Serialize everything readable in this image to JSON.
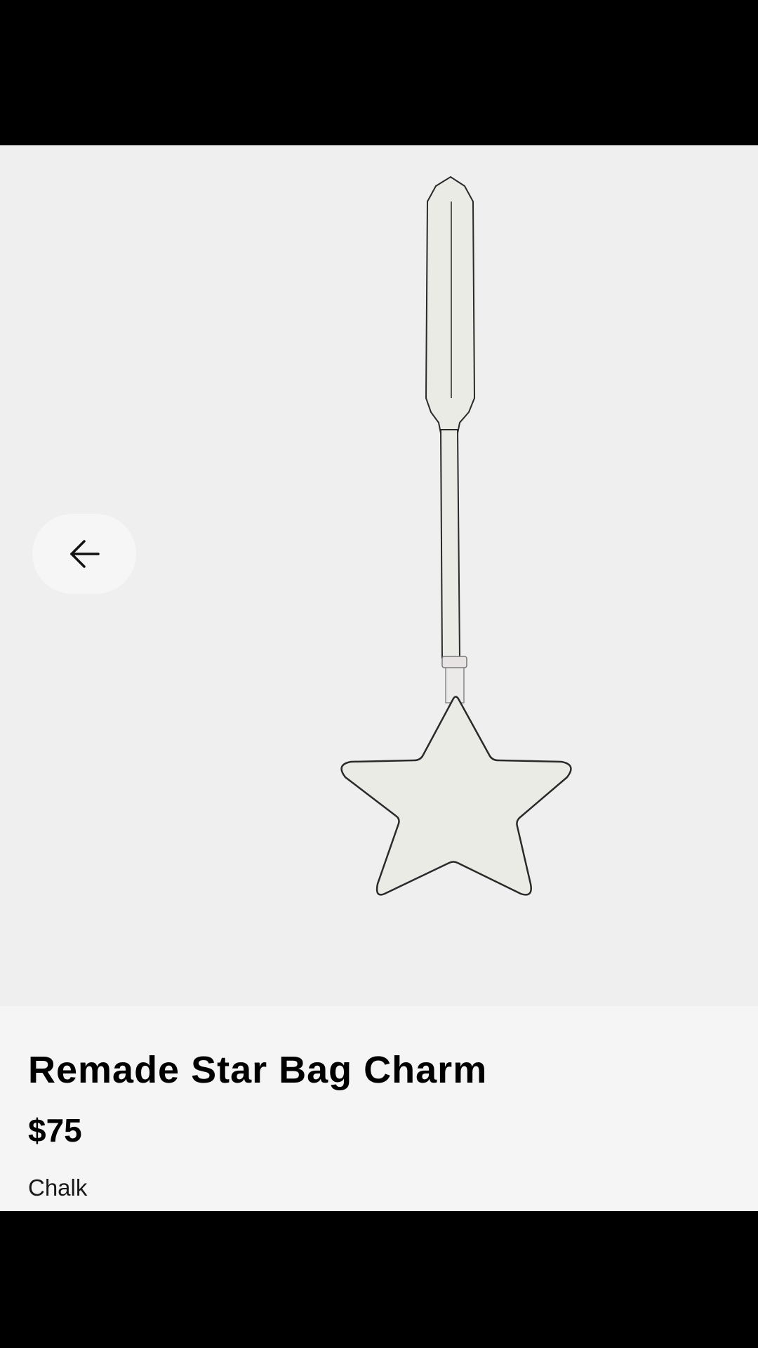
{
  "product": {
    "title": "Remade Star Bag Charm",
    "price": "$75",
    "color_name": "Chalk"
  },
  "image_area": {
    "background": "#efeff0",
    "subject": "star-bag-charm"
  },
  "back_button": {
    "icon": "arrow-left-icon"
  },
  "colors": {
    "system_bars": "#000000",
    "info_background": "#f5f5f5",
    "charm_fill": "#ebebe6",
    "charm_stroke": "#2a2a2a"
  }
}
